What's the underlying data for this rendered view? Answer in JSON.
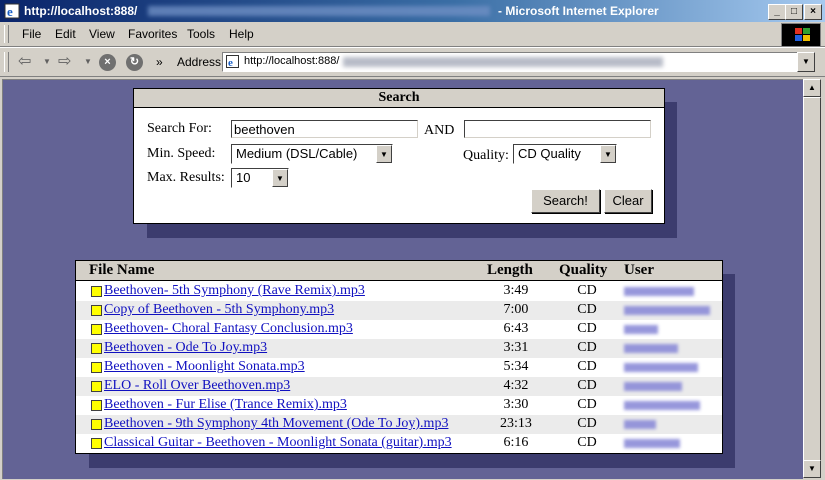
{
  "window": {
    "title_url": "http://localhost:888/",
    "app_name": "- Microsoft Internet Explorer",
    "minimize": "_",
    "maximize": "□",
    "close": "×"
  },
  "menu": [
    "File",
    "Edit",
    "View",
    "Favorites",
    "Tools",
    "Help"
  ],
  "toolbar": {
    "chevron": "»",
    "address_label": "Address",
    "address_url": "http://localhost:888/"
  },
  "search": {
    "title": "Search",
    "search_for_label": "Search For:",
    "search_for_value": "beethoven",
    "and_label": "AND",
    "and_value": "",
    "min_speed_label": "Min. Speed:",
    "min_speed_value": "Medium (DSL/Cable)",
    "quality_label": "Quality:",
    "quality_value": "CD Quality",
    "max_results_label": "Max. Results:",
    "max_results_value": "10",
    "search_button": "Search!",
    "clear_button": "Clear"
  },
  "results": {
    "headers": {
      "file_name": "File Name",
      "length": "Length",
      "quality": "Quality",
      "user": "User"
    },
    "rows": [
      {
        "file": "Beethoven- 5th Symphony (Rave Remix).mp3",
        "length": "3:49",
        "quality": "CD"
      },
      {
        "file": "Copy of Beethoven - 5th Symphony.mp3",
        "length": "7:00",
        "quality": "CD"
      },
      {
        "file": "Beethoven- Choral Fantasy Conclusion.mp3",
        "length": "6:43",
        "quality": "CD"
      },
      {
        "file": "Beethoven - Ode To Joy.mp3",
        "length": "3:31",
        "quality": "CD"
      },
      {
        "file": "Beethoven - Moonlight Sonata.mp3",
        "length": "5:34",
        "quality": "CD"
      },
      {
        "file": "ELO - Roll Over Beethoven.mp3",
        "length": "4:32",
        "quality": "CD"
      },
      {
        "file": "Beethoven - Fur Elise (Trance Remix).mp3",
        "length": "3:30",
        "quality": "CD"
      },
      {
        "file": "Beethoven - 9th Symphony 4th Movement (Ode To Joy).mp3",
        "length": "23:13",
        "quality": "CD"
      },
      {
        "file": "Classical Guitar - Beethoven - Moonlight Sonata (guitar).mp3",
        "length": "6:16",
        "quality": "CD"
      }
    ]
  },
  "colors": {
    "page_background": "#636395",
    "link": "#1010c0",
    "file_marker": "#ffff00"
  }
}
